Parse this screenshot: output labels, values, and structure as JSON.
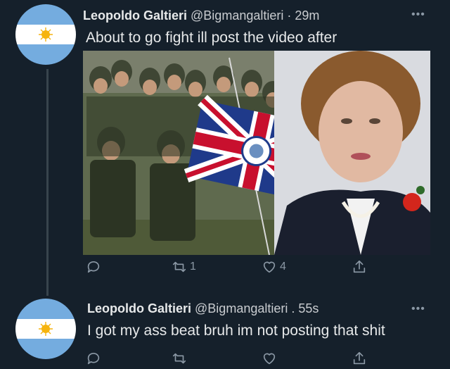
{
  "tweets": [
    {
      "name": "Leopoldo Galtieri",
      "handle": "@Bigmangaltieri",
      "separator": "·",
      "time": "29m",
      "text": "About to go fight ill post the video after",
      "more": "•••",
      "actions": {
        "reply_count": "",
        "retweet_count": "1",
        "like_count": "4"
      },
      "avatar_flag": "argentina",
      "media": [
        "soldiers-with-union-jack-photo",
        "woman-portrait-photo"
      ]
    },
    {
      "name": "Leopoldo Galtieri",
      "handle": "@Bigmangaltieri",
      "separator": ".",
      "time": "55s",
      "text": "I got my ass beat bruh im not posting that shit",
      "more": "•••",
      "actions": {
        "reply_count": "",
        "retweet_count": "",
        "like_count": ""
      },
      "avatar_flag": "argentina"
    }
  ],
  "colors": {
    "background": "#15202b",
    "icon": "#8b98a5",
    "text": "#e7e9ea",
    "thread_line": "#38444d",
    "flag_blue": "#74acdf",
    "flag_white": "#ffffff",
    "flag_sun": "#f6b40e"
  }
}
